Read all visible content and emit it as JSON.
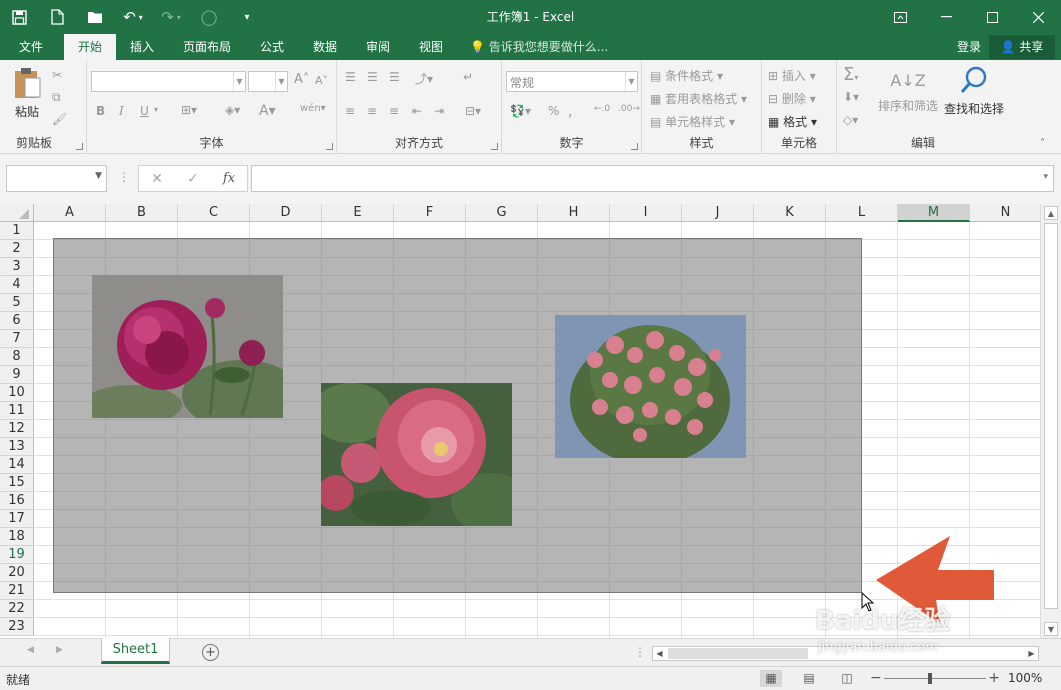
{
  "window": {
    "title": "工作簿1 - Excel"
  },
  "tabs": [
    {
      "label": "文件"
    },
    {
      "label": "开始"
    },
    {
      "label": "插入"
    },
    {
      "label": "页面布局"
    },
    {
      "label": "公式"
    },
    {
      "label": "数据"
    },
    {
      "label": "审阅"
    },
    {
      "label": "视图"
    }
  ],
  "tellme": "告诉我您想要做什么...",
  "account": {
    "login": "登录",
    "share": "共享"
  },
  "ribbon": {
    "clipboard": {
      "paste": "粘贴",
      "group": "剪贴板"
    },
    "font": {
      "group": "字体",
      "bold": "B",
      "italic": "I",
      "underline": "U"
    },
    "alignment": {
      "group": "对齐方式"
    },
    "number": {
      "group": "数字",
      "format": "常规"
    },
    "styles": {
      "group": "样式",
      "conditional": "条件格式",
      "table": "套用表格格式",
      "cell": "单元格样式"
    },
    "cells": {
      "group": "单元格",
      "insert": "插入",
      "delete": "删除",
      "format": "格式"
    },
    "editing": {
      "group": "编辑",
      "sort": "排序和筛选",
      "find": "查找和选择"
    }
  },
  "formula_bar": {
    "fx": "fx"
  },
  "columns": [
    "A",
    "B",
    "C",
    "D",
    "E",
    "F",
    "G",
    "H",
    "I",
    "J",
    "K",
    "L",
    "M",
    "N"
  ],
  "rows": [
    "1",
    "2",
    "3",
    "4",
    "5",
    "6",
    "7",
    "8",
    "9",
    "10",
    "11",
    "12",
    "13",
    "14",
    "15",
    "16",
    "17",
    "18",
    "19",
    "20",
    "21",
    "22",
    "23"
  ],
  "selected_column": "M",
  "selected_row": "19",
  "pictures": [
    {
      "subject": "peony-picture"
    },
    {
      "subject": "camellia-picture"
    },
    {
      "subject": "rose-bush-picture"
    }
  ],
  "sheets": [
    {
      "name": "Sheet1",
      "active": true
    }
  ],
  "status": {
    "text": "就绪",
    "zoom": "100%"
  },
  "watermark": {
    "line1": "Baidu经验",
    "line2": "jingyan.baidu.com"
  },
  "colors": {
    "excel_green": "#217346",
    "annotation_arrow": "#e05a3a"
  }
}
